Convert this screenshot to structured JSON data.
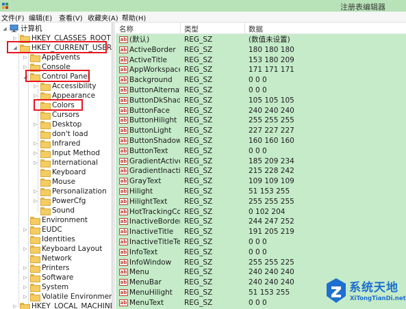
{
  "window": {
    "title": "注册表编辑器"
  },
  "menu": [
    "文件(F)",
    "编辑(E)",
    "查看(V)",
    "收藏夹(A)",
    "帮助(H)"
  ],
  "tree": {
    "root": "计算机",
    "hkcr": "HKEY_CLASSES_ROOT",
    "hkcu": "HKEY_CURRENT_USER",
    "hklm": "HKEY_LOCAL_MACHINE",
    "hkcu_children": [
      "AppEvents",
      "Console",
      "Control Panel"
    ],
    "control_panel_children": [
      "Accessibility",
      "Appearance",
      "Colors",
      "Cursors",
      "Desktop",
      "don't load",
      "Infrared",
      "Input Method",
      "International",
      "Keyboard",
      "Mouse",
      "Personalization",
      "PowerCfg",
      "Sound"
    ],
    "hkcu_more": [
      "Environment",
      "EUDC",
      "Identities",
      "Keyboard Layout",
      "Network",
      "Printers",
      "Software",
      "System",
      "Volatile Environment"
    ],
    "selected": "Colors"
  },
  "list": {
    "columns": {
      "name": "名称",
      "type": "类型",
      "data": "数据"
    },
    "rows": [
      {
        "name": "(默认)",
        "type": "REG_SZ",
        "data": "(数值未设置)"
      },
      {
        "name": "ActiveBorder",
        "type": "REG_SZ",
        "data": "180 180 180"
      },
      {
        "name": "ActiveTitle",
        "type": "REG_SZ",
        "data": "153 180 209"
      },
      {
        "name": "AppWorkspace",
        "type": "REG_SZ",
        "data": "171 171 171"
      },
      {
        "name": "Background",
        "type": "REG_SZ",
        "data": "0 0 0"
      },
      {
        "name": "ButtonAlternat...",
        "type": "REG_SZ",
        "data": "0 0 0"
      },
      {
        "name": "ButtonDkShad...",
        "type": "REG_SZ",
        "data": "105 105 105"
      },
      {
        "name": "ButtonFace",
        "type": "REG_SZ",
        "data": "240 240 240"
      },
      {
        "name": "ButtonHilight",
        "type": "REG_SZ",
        "data": "255 255 255"
      },
      {
        "name": "ButtonLight",
        "type": "REG_SZ",
        "data": "227 227 227"
      },
      {
        "name": "ButtonShadow",
        "type": "REG_SZ",
        "data": "160 160 160"
      },
      {
        "name": "ButtonText",
        "type": "REG_SZ",
        "data": "0 0 0"
      },
      {
        "name": "GradientActive...",
        "type": "REG_SZ",
        "data": "185 209 234"
      },
      {
        "name": "GradientInactiv...",
        "type": "REG_SZ",
        "data": "215 228 242"
      },
      {
        "name": "GrayText",
        "type": "REG_SZ",
        "data": "109 109 109"
      },
      {
        "name": "Hilight",
        "type": "REG_SZ",
        "data": "51 153 255"
      },
      {
        "name": "HilightText",
        "type": "REG_SZ",
        "data": "255 255 255"
      },
      {
        "name": "HotTrackingCo...",
        "type": "REG_SZ",
        "data": "0 102 204"
      },
      {
        "name": "InactiveBorder",
        "type": "REG_SZ",
        "data": "244 247 252"
      },
      {
        "name": "InactiveTitle",
        "type": "REG_SZ",
        "data": "191 205 219"
      },
      {
        "name": "InactiveTitleText",
        "type": "REG_SZ",
        "data": "0 0 0"
      },
      {
        "name": "InfoText",
        "type": "REG_SZ",
        "data": "0 0 0"
      },
      {
        "name": "InfoWindow",
        "type": "REG_SZ",
        "data": "255 255 225"
      },
      {
        "name": "Menu",
        "type": "REG_SZ",
        "data": "240 240 240"
      },
      {
        "name": "MenuBar",
        "type": "REG_SZ",
        "data": "240 240 240"
      },
      {
        "name": "MenuHilight",
        "type": "REG_SZ",
        "data": "51 153 255"
      },
      {
        "name": "MenuText",
        "type": "REG_SZ",
        "data": "0 0 0"
      }
    ]
  },
  "watermark": {
    "text": "系统天地",
    "url": "XiTongTianDi.net"
  },
  "colors": {
    "titlebar": "#b8e3b8",
    "list_bg": "#c5ebc9",
    "highlight": "#e8141e",
    "folder": "#f4cc62"
  }
}
